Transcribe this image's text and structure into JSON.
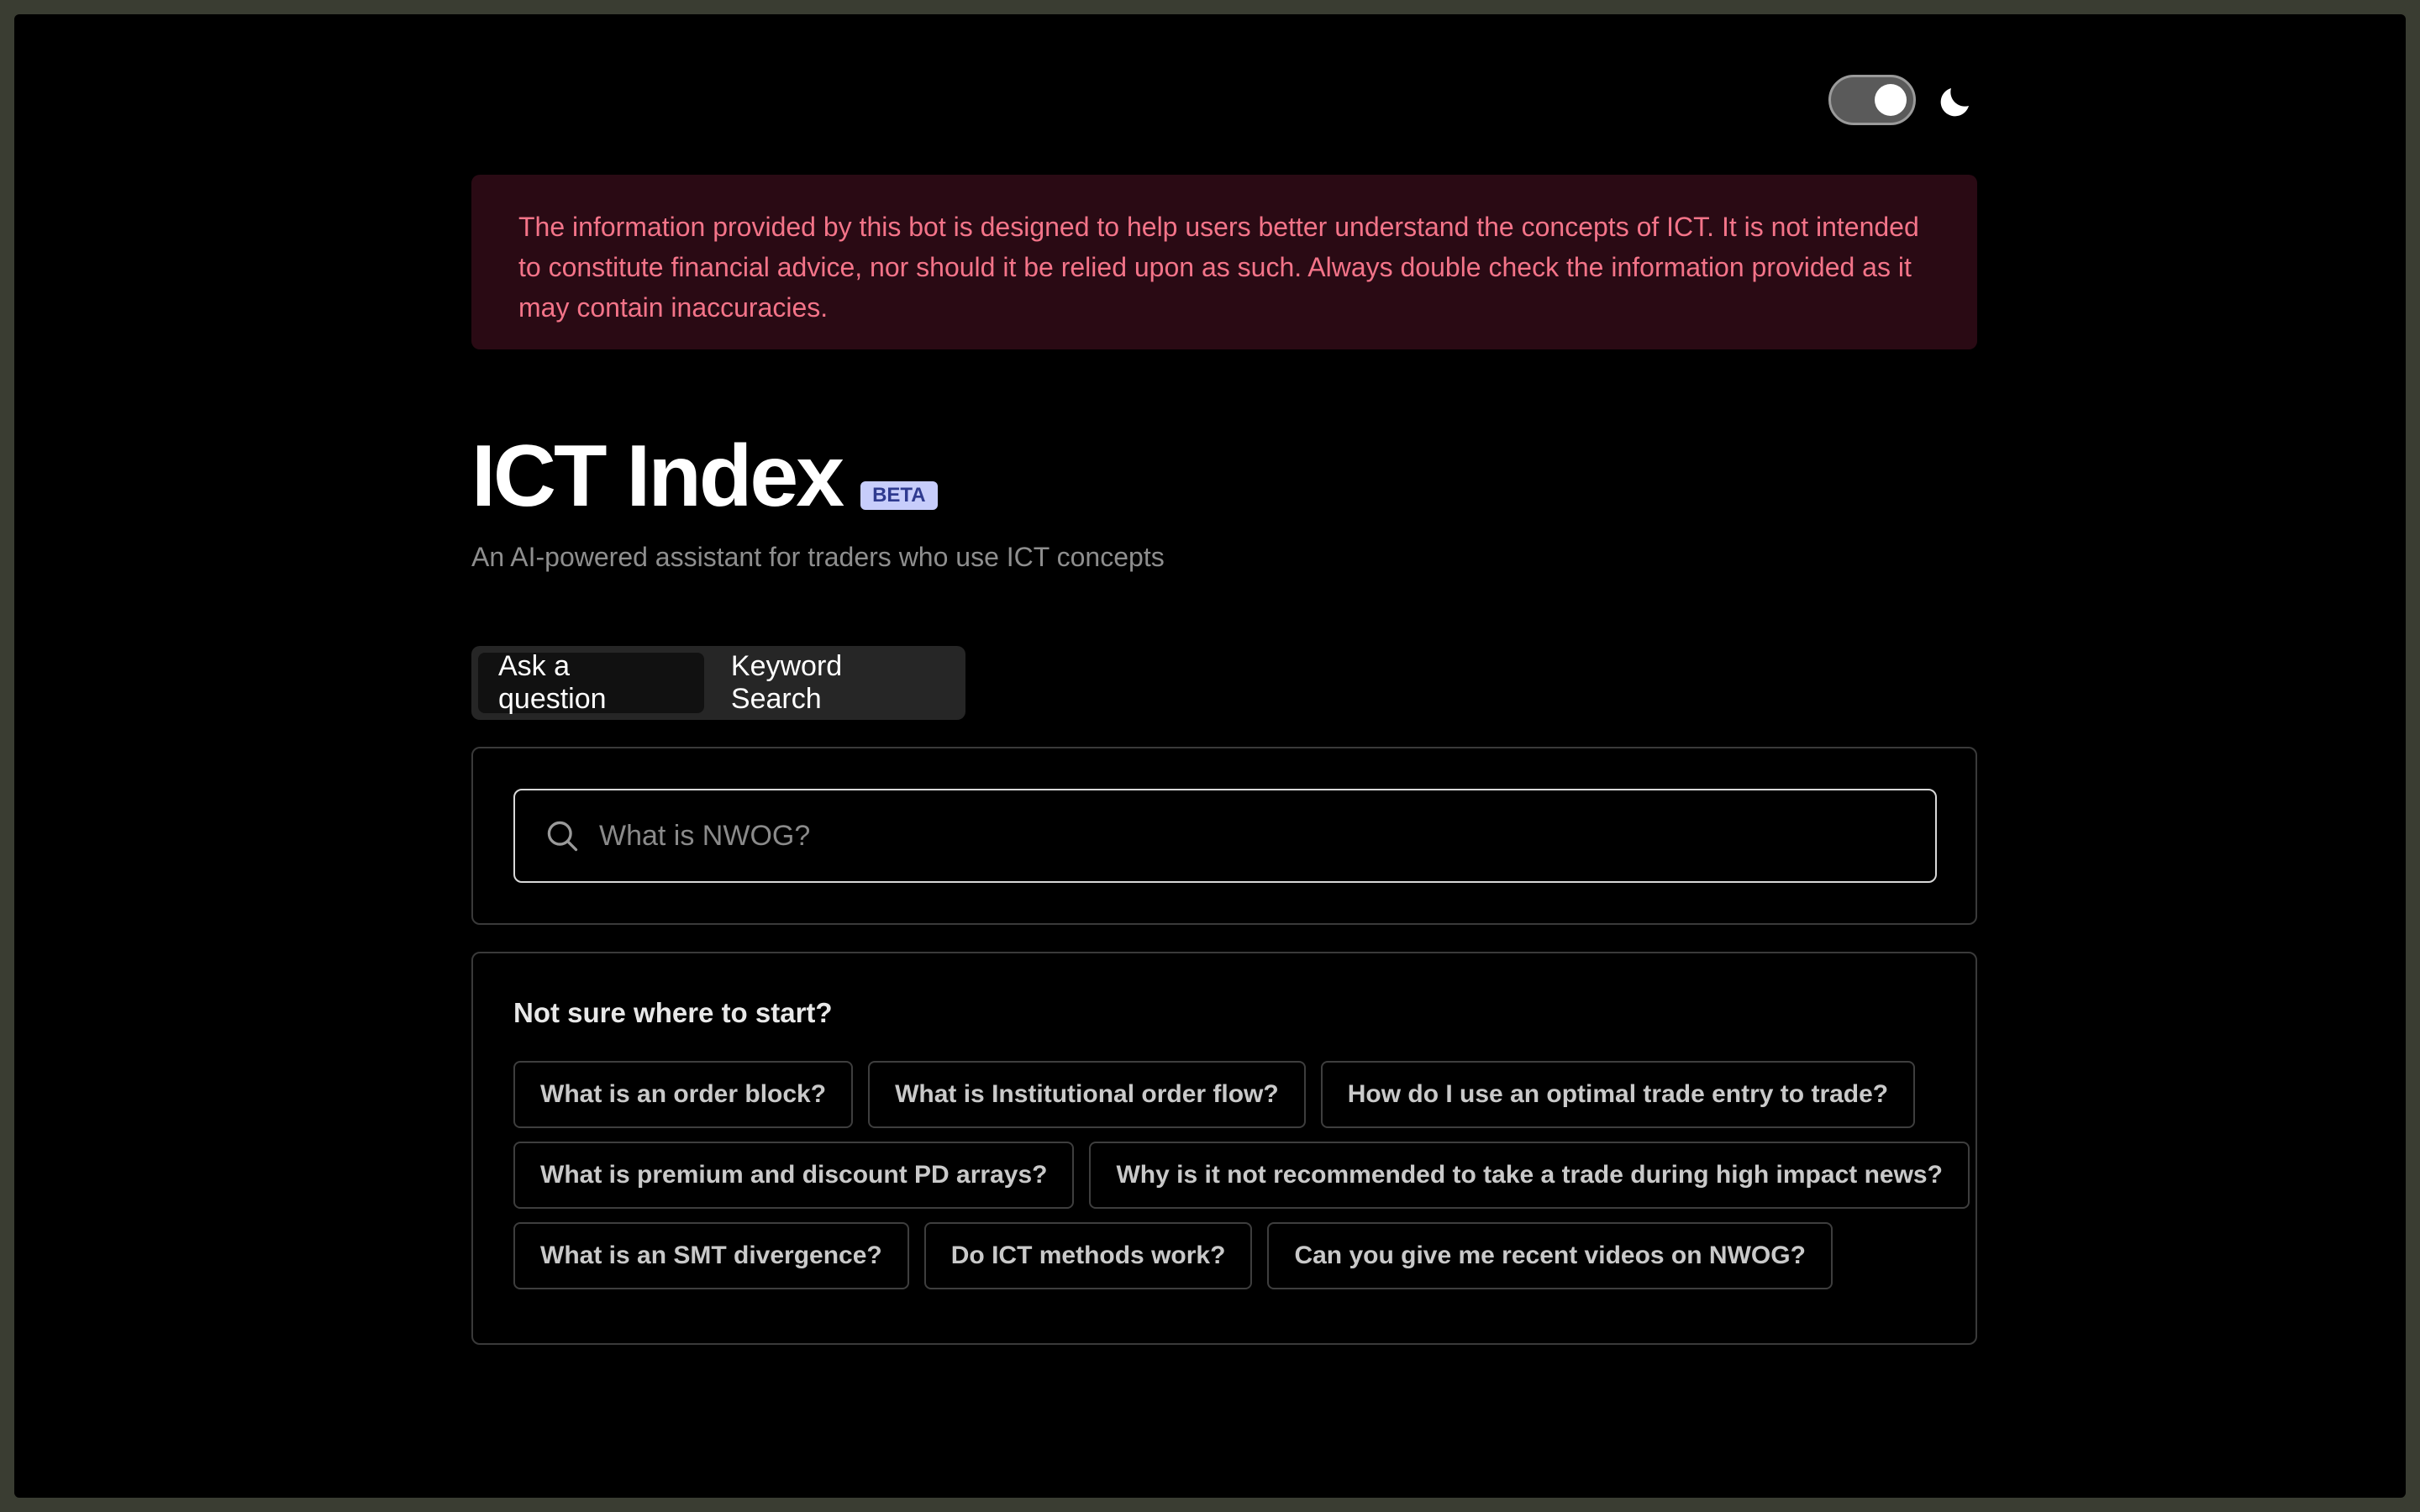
{
  "disclaimer": {
    "text": "The information provided by this bot is designed to help users better understand the concepts of ICT. It is not intended to constitute financial advice, nor should it be relied upon as such. Always double check the information provided as it may contain inaccuracies."
  },
  "header": {
    "title": "ICT Index",
    "badge": "BETA",
    "subtitle": "An AI-powered assistant for traders who use ICT concepts"
  },
  "theme": {
    "toggle_on": true,
    "icon": "moon-icon"
  },
  "tabs": [
    {
      "label": "Ask a question",
      "active": true
    },
    {
      "label": "Keyword Search",
      "active": false
    }
  ],
  "search": {
    "placeholder": "What is NWOG?",
    "value": ""
  },
  "suggestions": {
    "heading": "Not sure where to start?",
    "rows": [
      [
        "What is an order block?",
        "What is Institutional order flow?",
        "How do I use an optimal trade entry to trade?"
      ],
      [
        "What is premium and discount PD arrays?",
        "Why is it not recommended to take a trade during high impact news?"
      ],
      [
        "What is an SMT divergence?",
        "Do ICT methods work?",
        "Can you give me recent videos on NWOG?"
      ]
    ]
  },
  "colors": {
    "background": "#000000",
    "disclaimer_bg": "#2a0a14",
    "disclaimer_text": "#f47489",
    "badge_bg": "#c7cdfb",
    "badge_text": "#2e3a8f"
  }
}
